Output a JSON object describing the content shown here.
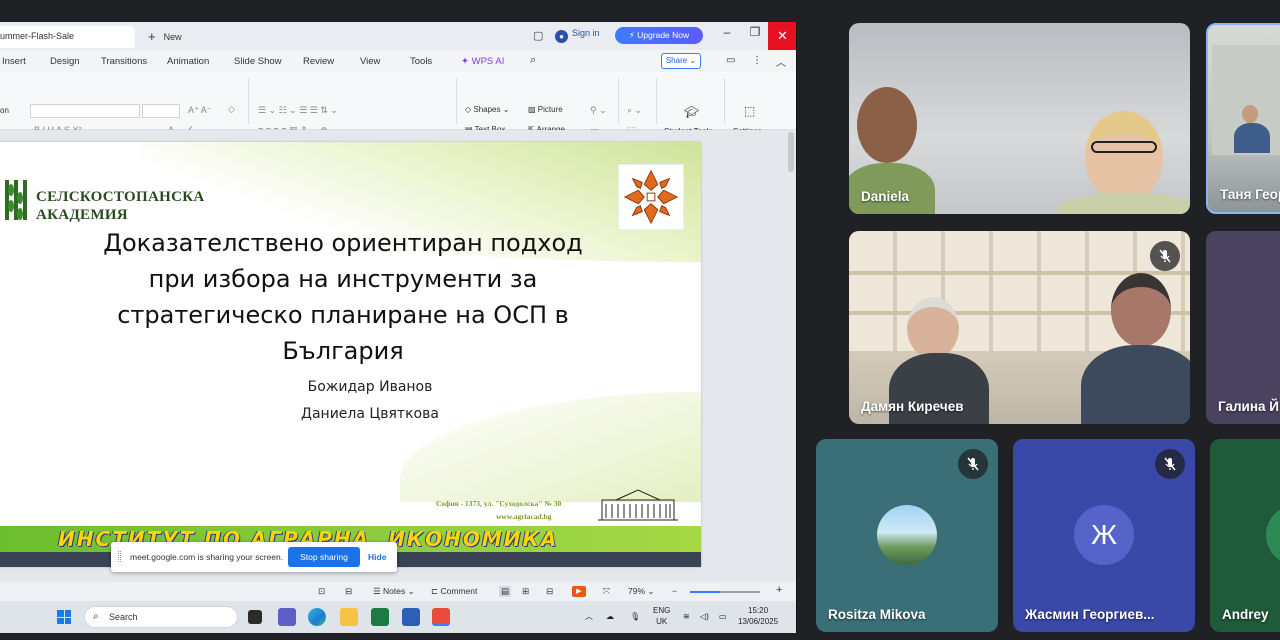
{
  "wps": {
    "doc_tab": "ummer-Flash-Sale",
    "new_tab_label": "New",
    "sign_in": "Sign in",
    "upgrade": "Upgrade Now",
    "menu": [
      "Insert",
      "Design",
      "Transitions",
      "Animation",
      "Slide Show",
      "Review",
      "View",
      "Tools",
      "WPS AI"
    ],
    "share": "Share",
    "ribbon": {
      "shapes": "Shapes",
      "picture": "Picture",
      "text_box": "Text Box",
      "arrange": "Arrange",
      "student_tools": "Student Tools",
      "settings": "Settings",
      "left_label": "on"
    },
    "status": {
      "notes": "Notes",
      "comment": "Comment",
      "zoom": "79%"
    }
  },
  "slide": {
    "academy": [
      "СЕЛСКОСТОПАНСКА",
      "АКАДЕМИЯ"
    ],
    "title_lines": [
      "Доказателствено ориентиран подход",
      "при избора на инструменти за",
      "стратегическо планиране на ОСП в",
      "България"
    ],
    "author1": "Божидар Иванов",
    "author2": "Даниела Цвяткова",
    "address1": "София - 1373, ул. \"Суходолска\" № 30",
    "address2": "www.agriacad.bg",
    "banner": "ИНСТИТУТ ПО АГРАРНА  ИКОНОМИКА"
  },
  "share_bar": {
    "message": "meet.google.com is sharing your screen.",
    "stop": "Stop sharing",
    "hide": "Hide"
  },
  "taskbar": {
    "search": "Search",
    "lang1": "ENG",
    "lang2": "UK",
    "time": "15:20",
    "date": "13/06/2025"
  },
  "participants": [
    {
      "name": "Daniela",
      "muted": false
    },
    {
      "name": "Таня Геор",
      "muted": false
    },
    {
      "name": "Дамян Киречев",
      "muted": true
    },
    {
      "name": "Галина Й",
      "muted": false
    },
    {
      "name": "Rositza Mikova",
      "muted": true
    },
    {
      "name": "Жасмин Георгиев...",
      "muted": true,
      "initial": "Ж"
    },
    {
      "name": "Andrey",
      "muted": false
    }
  ]
}
